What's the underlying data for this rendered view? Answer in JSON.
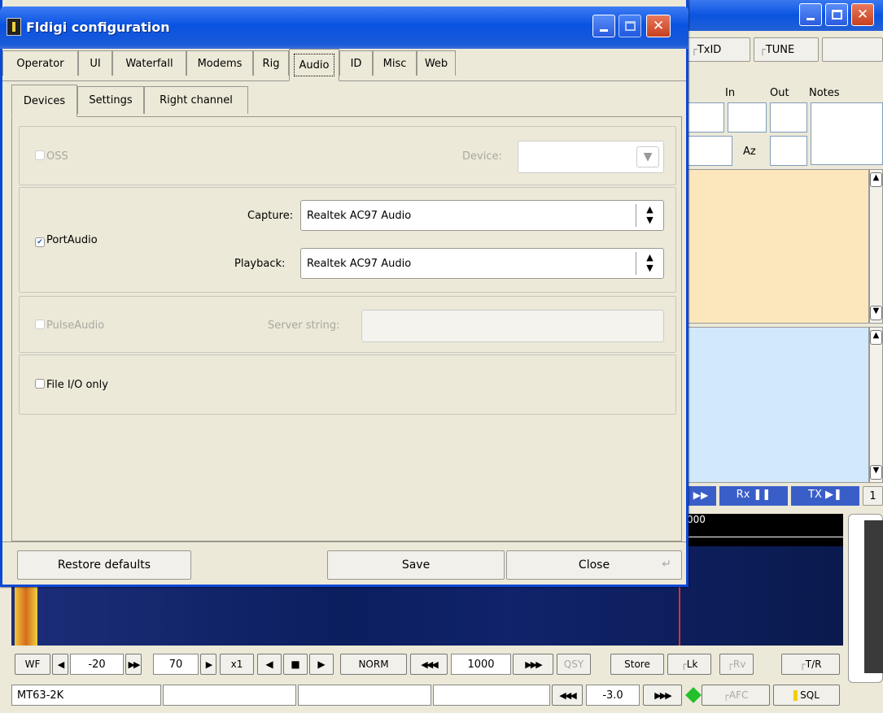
{
  "dialog": {
    "title": "Fldigi configuration",
    "tabs": [
      "Operator",
      "UI",
      "Waterfall",
      "Modems",
      "Rig",
      "Audio",
      "ID",
      "Misc",
      "Web"
    ],
    "subtabs": [
      "Devices",
      "Settings",
      "Right channel"
    ],
    "oss": {
      "label": "OSS",
      "device_label": "Device:"
    },
    "portaudio": {
      "label": "PortAudio",
      "capture_label": "Capture:",
      "capture_value": "Realtek AC97 Audio",
      "playback_label": "Playback:",
      "playback_value": "Realtek AC97 Audio"
    },
    "pulse": {
      "label": "PulseAudio",
      "server_label": "Server string:"
    },
    "fileio": {
      "label": "File I/O only"
    },
    "restore": "Restore defaults",
    "save": "Save",
    "close": "Close"
  },
  "main": {
    "txid": "TxID",
    "tune": "TUNE",
    "col_in": "In",
    "col_out": "Out",
    "col_notes": "Notes",
    "az": "Az",
    "rx": "Rx",
    "tx": "TX",
    "side_one": "1",
    "scale_label": "000"
  },
  "bottom": {
    "wf": "WF",
    "val1": "-20",
    "val2": "70",
    "x1": "x1",
    "norm": "NORM",
    "freq": "1000",
    "qsy": "QSY",
    "store": "Store",
    "lk": "Lk",
    "rv": "Rv",
    "tr": "T/R",
    "mode": "MT63-2K",
    "sq_val": "-3.0",
    "afc": "AFC",
    "sql": "SQL"
  }
}
